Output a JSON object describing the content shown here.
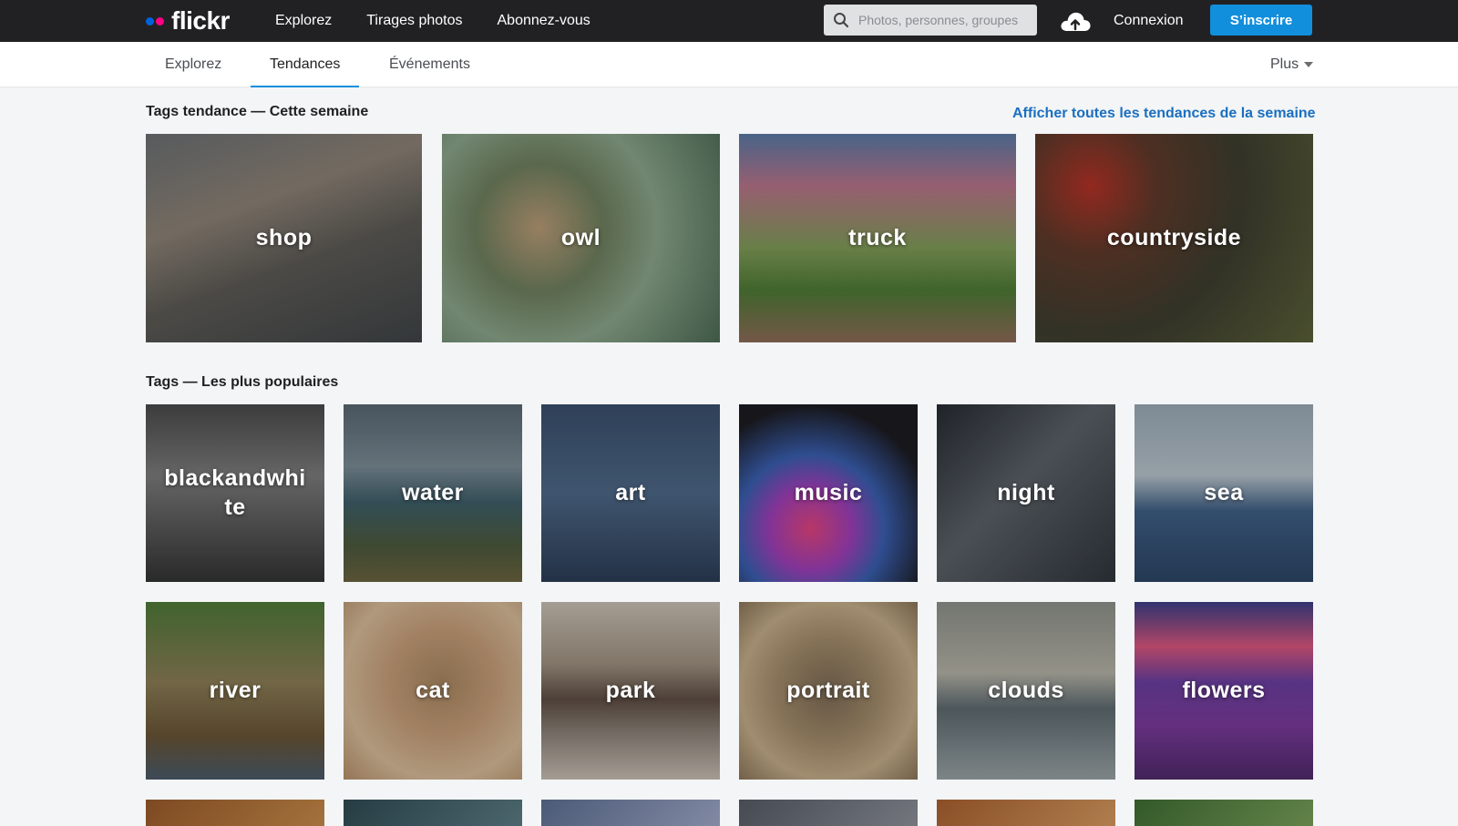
{
  "topbar": {
    "logo_text": "flickr",
    "nav": [
      "Explorez",
      "Tirages photos",
      "Abonnez-vous"
    ],
    "search_placeholder": "Photos, personnes, groupes",
    "signin_label": "Connexion",
    "signup_label": "S’inscrire",
    "colors": {
      "bar": "#212124",
      "logo_blue": "#0063dc",
      "logo_pink": "#ff0084",
      "signup": "#128fdc"
    }
  },
  "subnav": {
    "tabs": [
      "Explorez",
      "Tendances",
      "Événements"
    ],
    "active_tab": "Tendances",
    "more_label": "Plus"
  },
  "trending": {
    "title": "Tags tendance — Cette semaine",
    "see_all_label": "Afficher toutes les tendances de la semaine",
    "tags": [
      "shop",
      "owl",
      "truck",
      "countryside"
    ]
  },
  "popular": {
    "title": "Tags — Les plus populaires",
    "tags": [
      "blackandwhite",
      "water",
      "art",
      "music",
      "night",
      "sea",
      "river",
      "cat",
      "park",
      "portrait",
      "clouds",
      "flowers"
    ]
  }
}
